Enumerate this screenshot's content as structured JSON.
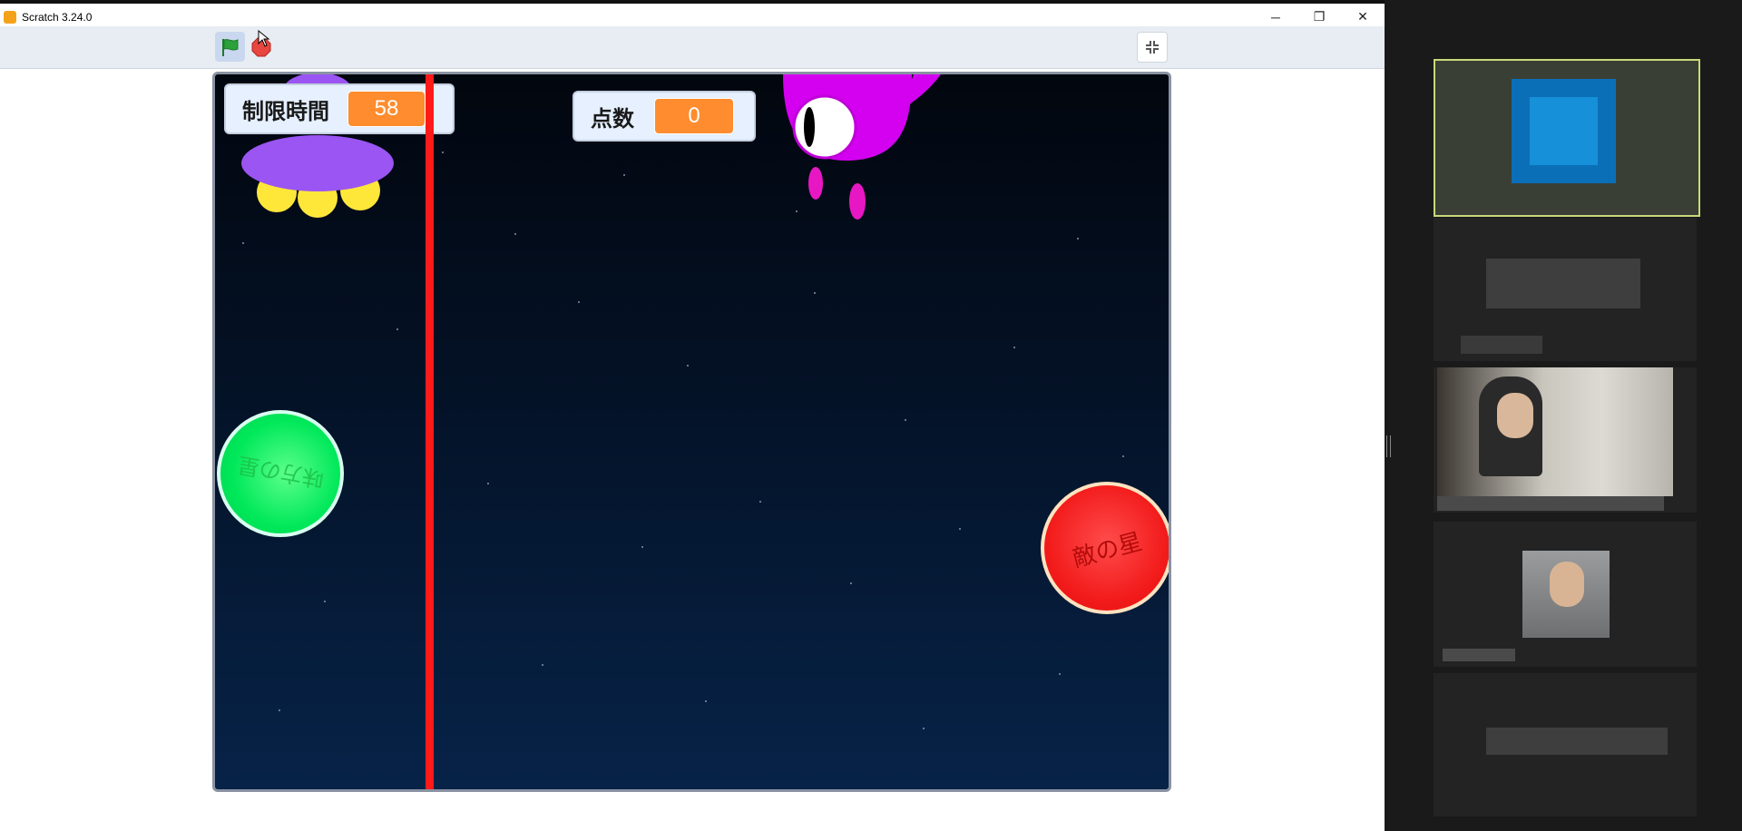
{
  "window": {
    "title": "Scratch 3.24.0",
    "controls": {
      "minimize": "─",
      "restore": "❐",
      "close": "✕"
    }
  },
  "toolbar": {
    "green_flag": "green-flag-icon",
    "stop": "stop-icon",
    "unfullscreen": "unfullscreen-icon"
  },
  "stage": {
    "timer_monitor": {
      "label": "制限時間",
      "value": "58"
    },
    "score_monitor": {
      "label": "点数",
      "value": "0"
    },
    "ally_planet_label": "味方の星",
    "enemy_planet_label": "敵の星"
  },
  "colors": {
    "accent_orange": "#ff8c2e",
    "stage_top": "#02060e",
    "stage_bottom": "#072348",
    "barrier_red": "#ff1a1a",
    "ufo_purple": "#9b55f2",
    "alien_magenta": "#d400f0"
  }
}
